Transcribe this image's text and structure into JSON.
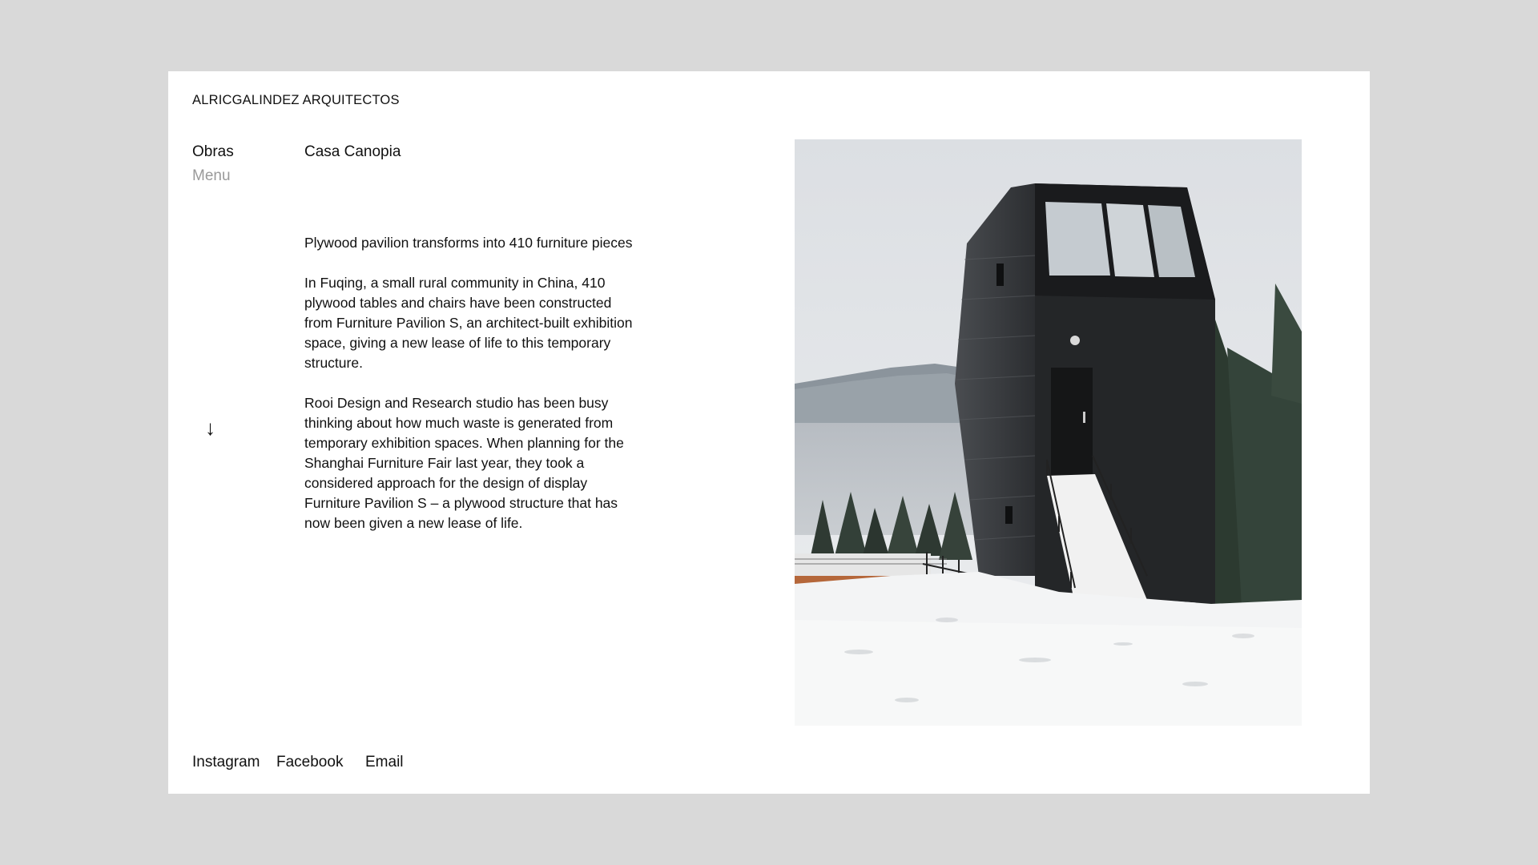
{
  "header": {
    "brand": "ALRICGALINDEZ ARQUITECTOS"
  },
  "nav": {
    "obras": "Obras",
    "menu": "Menu"
  },
  "project": {
    "title": "Casa Canopia",
    "paragraphs": [
      "Plywood pavilion transforms into 410 furniture pieces",
      "In Fuqing, a small rural community in China, 410 plywood tables and chairs have been constructed from Furniture Pavilion S, an architect-built exhibition space, giving a new lease of life to this temporary structure.",
      "Rooi Design and Research studio has been busy thinking about how much waste is generated from temporary exhibition spaces. When planning for the Shanghai Furniture Fair last year, they took a considered approach for the design of display Furniture Pavilion S – a plywood structure that has now been given a new lease of life."
    ],
    "scroll_glyph": "↓"
  },
  "footer": {
    "instagram": "Instagram",
    "facebook": "Facebook",
    "email": "Email"
  },
  "colors": {
    "background": "#d9d9d9",
    "panel": "#ffffff",
    "text": "#111111",
    "muted": "#9a9a9a"
  }
}
